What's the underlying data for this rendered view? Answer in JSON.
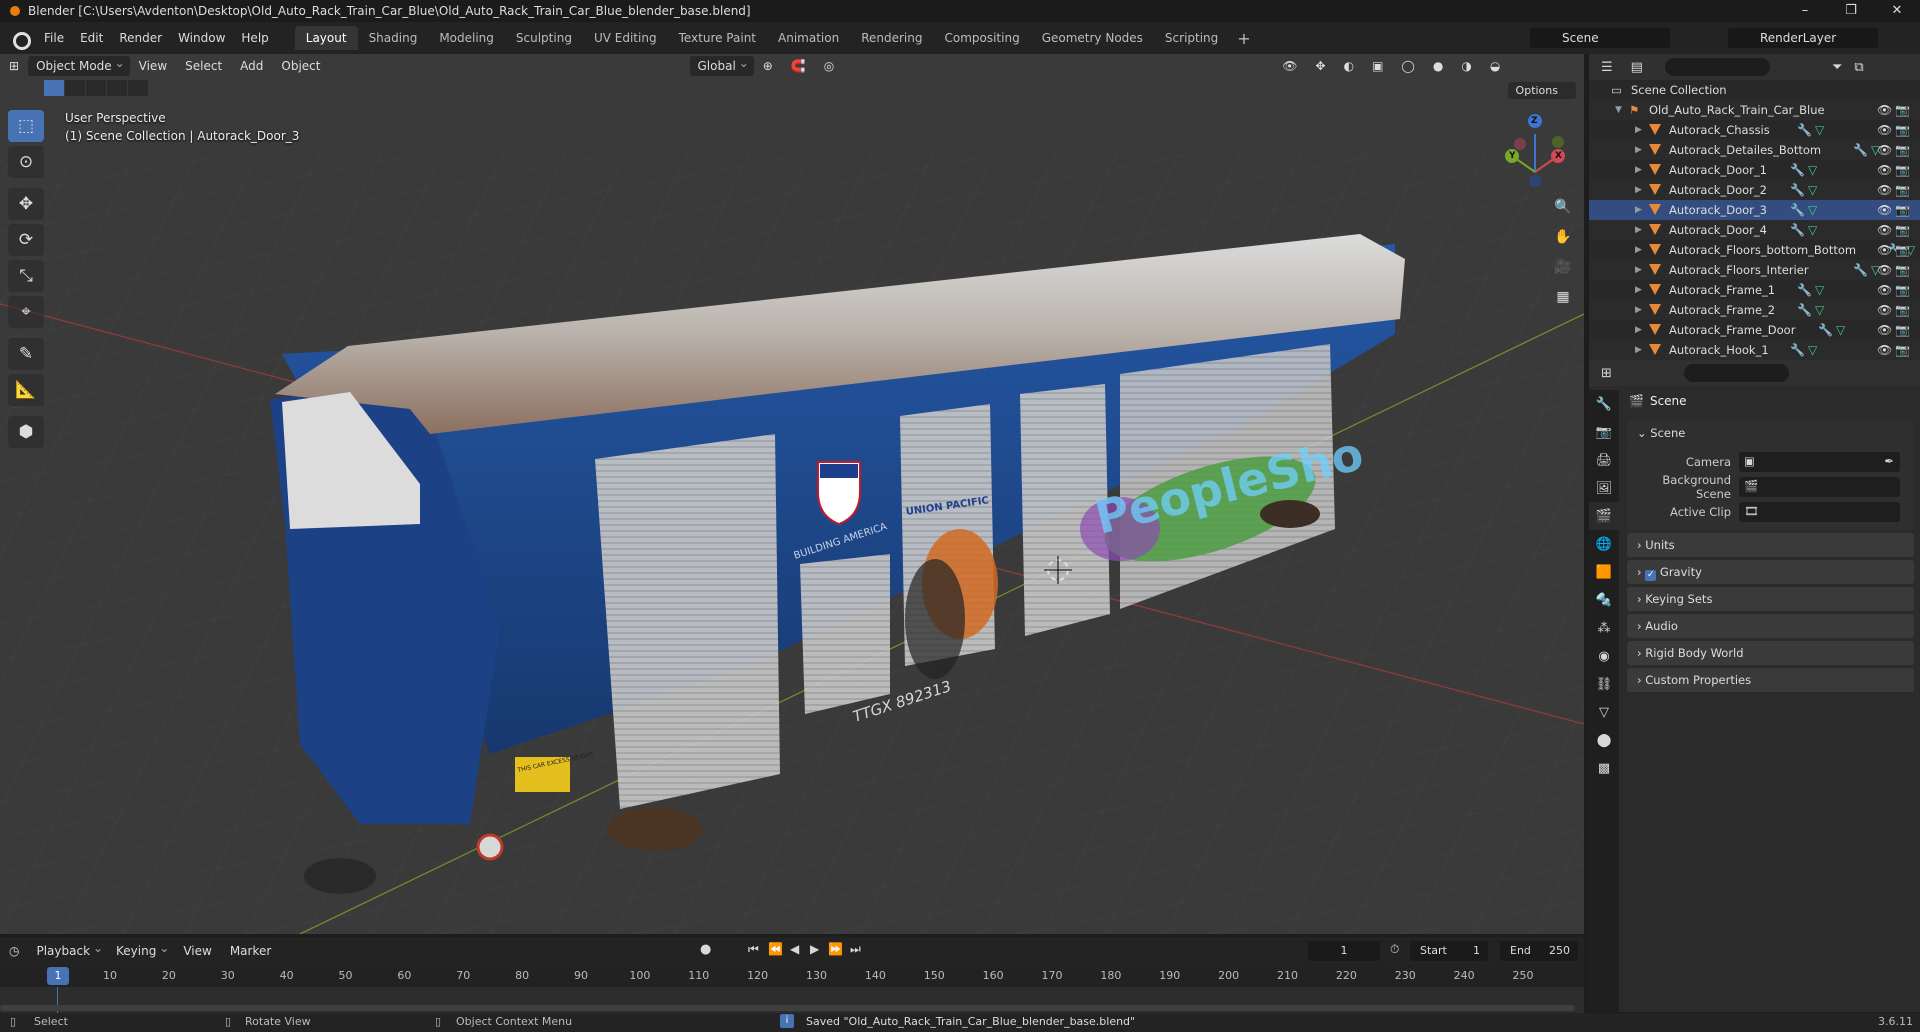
{
  "window": {
    "title": "Blender [C:\\Users\\Avdenton\\Desktop\\Old_Auto_Rack_Train_Car_Blue\\Old_Auto_Rack_Train_Car_Blue_blender_base.blend]",
    "controls": {
      "minimize": "–",
      "maximize": "❐",
      "close": "✕"
    }
  },
  "menubar": {
    "items": [
      "File",
      "Edit",
      "Render",
      "Window",
      "Help"
    ]
  },
  "workspaces": {
    "tabs": [
      "Layout",
      "Shading",
      "Modeling",
      "Sculpting",
      "UV Editing",
      "Texture Paint",
      "Animation",
      "Rendering",
      "Compositing",
      "Geometry Nodes",
      "Scripting"
    ],
    "active": "Layout",
    "add": "+"
  },
  "scene": {
    "name": "Scene",
    "view_layer": "RenderLayer"
  },
  "viewport": {
    "mode": "Object Mode",
    "menus": [
      "View",
      "Select",
      "Add",
      "Object"
    ],
    "orientation": "Global",
    "options": "Options",
    "perspective": "User Perspective",
    "context": "(1) Scene Collection | Autorack_Door_3",
    "gizmo": {
      "x": "X",
      "y": "Y",
      "z": "Z"
    },
    "model_text": {
      "company": "UNION PACIFIC",
      "slogan": "BUILDING AMERICA",
      "car_number": "TTGX 892313",
      "graffiti": "PeopleSho",
      "warning": "THIS CAR EXCESS HEIGHT"
    }
  },
  "outliner": {
    "root": "Scene Collection",
    "collection": "Old_Auto_Rack_Train_Car_Blue",
    "items": [
      "Autorack_Chassis",
      "Autorack_Detailes_Bottom",
      "Autorack_Door_1",
      "Autorack_Door_2",
      "Autorack_Door_3",
      "Autorack_Door_4",
      "Autorack_Floors_bottom_Bottom",
      "Autorack_Floors_Interier",
      "Autorack_Frame_1",
      "Autorack_Frame_2",
      "Autorack_Frame_Door",
      "Autorack_Hook_1"
    ],
    "selected": "Autorack_Door_3"
  },
  "properties": {
    "context_title": "Scene",
    "panel_scene": "Scene",
    "camera_label": "Camera",
    "background_label": "Background Scene",
    "clip_label": "Active Clip",
    "panels": [
      "Units",
      "Gravity",
      "Keying Sets",
      "Audio",
      "Rigid Body World",
      "Custom Properties"
    ],
    "gravity_enabled": true
  },
  "timeline": {
    "menus": [
      "Playback",
      "Keying",
      "View",
      "Marker"
    ],
    "current_frame": "1",
    "start_label": "Start",
    "start": "1",
    "end_label": "End",
    "end": "250",
    "ticks": [
      "1",
      "10",
      "20",
      "30",
      "40",
      "50",
      "60",
      "70",
      "80",
      "90",
      "100",
      "110",
      "120",
      "130",
      "140",
      "150",
      "160",
      "170",
      "180",
      "190",
      "200",
      "210",
      "220",
      "230",
      "240",
      "250"
    ]
  },
  "statusbar": {
    "select": "Select",
    "rotate": "Rotate View",
    "context_menu": "Object Context Menu",
    "message": "Saved \"Old_Auto_Rack_Train_Car_Blue_blender_base.blend\"",
    "version": "3.6.11"
  },
  "colors": {
    "accent": "#4772b3",
    "object_orange": "#e8893a",
    "car_blue": "#1f4d96",
    "roof_rust": "#a5683e"
  }
}
